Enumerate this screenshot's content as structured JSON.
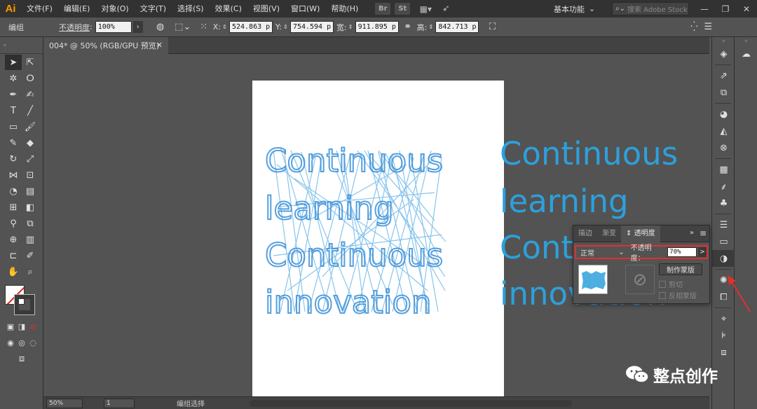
{
  "menubar": {
    "app_logo": "Ai",
    "items": [
      "文件(F)",
      "编辑(E)",
      "对象(O)",
      "文字(T)",
      "选择(S)",
      "效果(C)",
      "视图(V)",
      "窗口(W)",
      "帮助(H)"
    ],
    "bridge": "Br",
    "stock": "St",
    "workspace": "基本功能",
    "search_placeholder": "搜索 Adobe Stock",
    "win_minimize": "—",
    "win_restore": "❐",
    "win_close": "✕"
  },
  "controlbar": {
    "selection_type": "编组",
    "opacity_label": "不透明度",
    "opacity_value": "100%",
    "x_label": "X:",
    "x_value": "524.863 p",
    "y_label": "Y:",
    "y_value": "754.594 p",
    "w_label": "宽:",
    "w_value": "911.895 p",
    "h_label": "高:",
    "h_value": "842.713 p"
  },
  "document": {
    "tab_title": "004* @ 50% (RGB/GPU 预览)",
    "tab_close": "✕"
  },
  "artwork": {
    "lines": [
      "Continuous",
      "learning",
      "Continuous",
      "innovation"
    ],
    "color": "#2da0dc"
  },
  "transparency_panel": {
    "tabs": [
      "描边",
      "渐变",
      "透明度"
    ],
    "collapse": "»",
    "menu": "≡",
    "blend_mode": "正常",
    "opacity_label": "不透明度：",
    "opacity_value": "70%",
    "arrow": ">",
    "make_mask": "制作蒙版",
    "clip_label": "剪切",
    "invert_label": "反相蒙版"
  },
  "statusbar": {
    "zoom": "50%",
    "page": "1",
    "status": "编组选择"
  },
  "watermark": {
    "text": "整点创作"
  },
  "colors": {
    "accent_red": "#e0302c",
    "art_blue": "#2da0dc"
  }
}
